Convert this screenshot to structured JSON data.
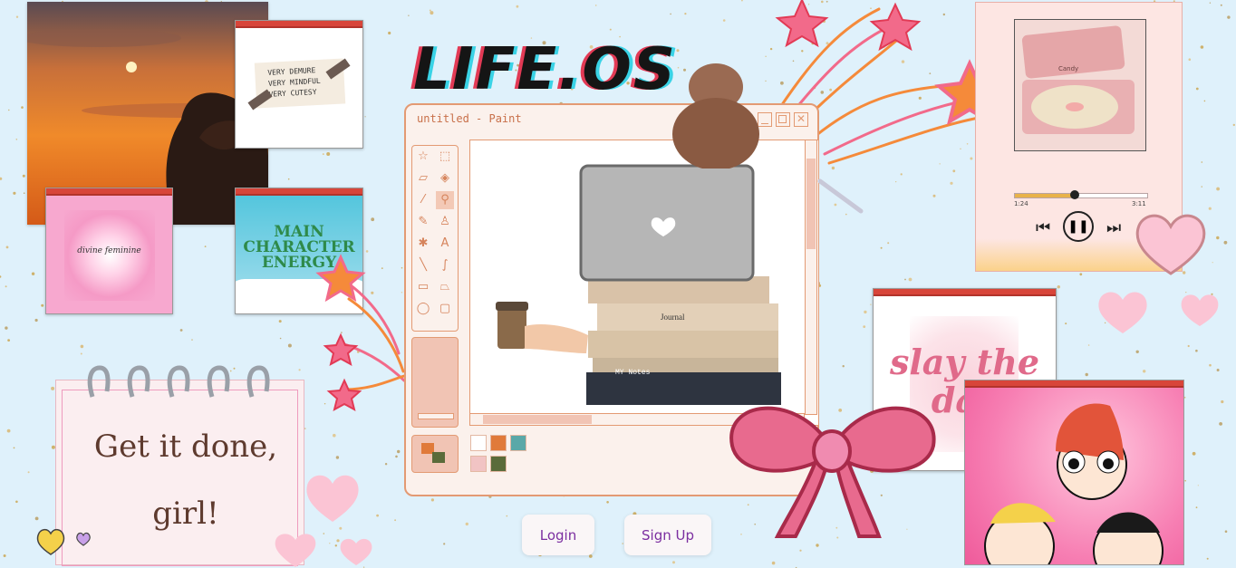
{
  "brand": {
    "title": "LIFE.OS"
  },
  "paint": {
    "window_title": "untitled - Paint"
  },
  "cards": {
    "vibe_sticker": {
      "line1": "VERY DEMURE",
      "line2": "VERY MINDFUL",
      "line3": "VERY CUTESY"
    },
    "divine": {
      "text": "divine feminine"
    },
    "main_character": {
      "line1": "MAIN",
      "line2": "CHARACTER",
      "line3": "ENERGY"
    },
    "slay": {
      "line1": "slay the",
      "line2": "day"
    },
    "notepad": {
      "line1": "Get it done,",
      "line2": "girl!"
    }
  },
  "illustration": {
    "book1": "Journal",
    "book2": "MY Notes"
  },
  "music": {
    "record_label": "Candy",
    "elapsed": "1:24",
    "duration": "3:11",
    "progress": 0.45
  },
  "auth": {
    "login_label": "Login",
    "signup_label": "Sign Up"
  },
  "colors": {
    "accent_purple": "#7b2ea0",
    "window_red": "#d8453a",
    "paint_orange": "#e39a73",
    "pink": "#f08bb0"
  },
  "icons": [
    "star-icon",
    "select-icon",
    "eraser-icon",
    "fill-icon",
    "picker-icon",
    "magnifier-icon",
    "pencil-icon",
    "brush-icon",
    "spray-icon",
    "text-icon",
    "line-icon",
    "curve-icon",
    "rectangle-icon",
    "polygon-icon",
    "ellipse-icon",
    "rounded-rect-icon",
    "prev-icon",
    "pause-icon",
    "next-icon",
    "heart-icon",
    "bow-icon"
  ]
}
